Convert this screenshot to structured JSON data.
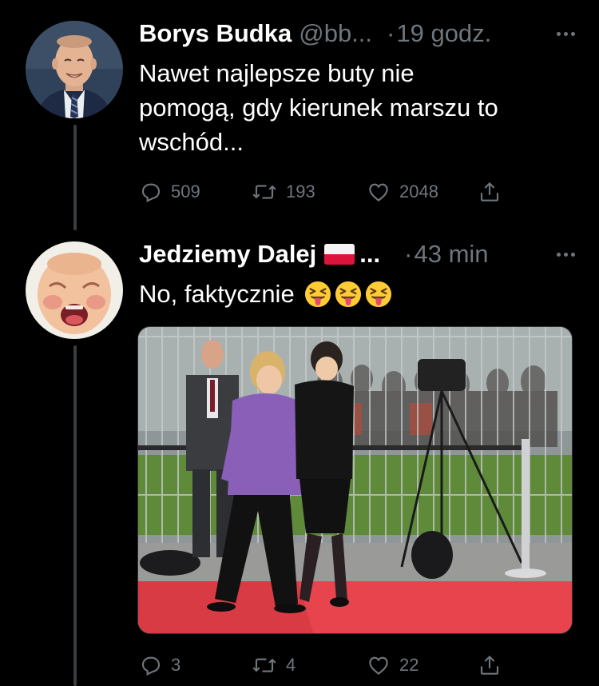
{
  "tweets": [
    {
      "display_name": "Borys Budka",
      "handle": "@bb...",
      "separator": "·",
      "time": "19 godz.",
      "text_lines": [
        "Nawet najlepsze buty nie",
        "pomogą, gdy kierunek marszu to",
        "wschód..."
      ],
      "actions": {
        "reply_count": "509",
        "retweet_count": "193",
        "like_count": "2048"
      }
    },
    {
      "display_name": "Jedziemy Dalej",
      "name_suffix": "...",
      "flag": "poland-flag",
      "handle": "",
      "separator": "·",
      "time": "43 min",
      "text": "No, faktycznie",
      "emojis": [
        "squinting-tongue-emoji",
        "squinting-tongue-emoji",
        "squinting-tongue-emoji"
      ],
      "actions": {
        "reply_count": "3",
        "retweet_count": "4",
        "like_count": "22"
      }
    }
  ],
  "icons": {
    "reply": "reply-icon",
    "retweet": "retweet-icon",
    "like": "like-icon",
    "share": "share-icon",
    "more": "more-icon"
  },
  "colors": {
    "background": "#000000",
    "text": "#ffffff",
    "secondary": "#6e767d",
    "thread_line": "#3a3d41",
    "carpet": "#e8444d",
    "jacket": "#8a5fb8"
  }
}
